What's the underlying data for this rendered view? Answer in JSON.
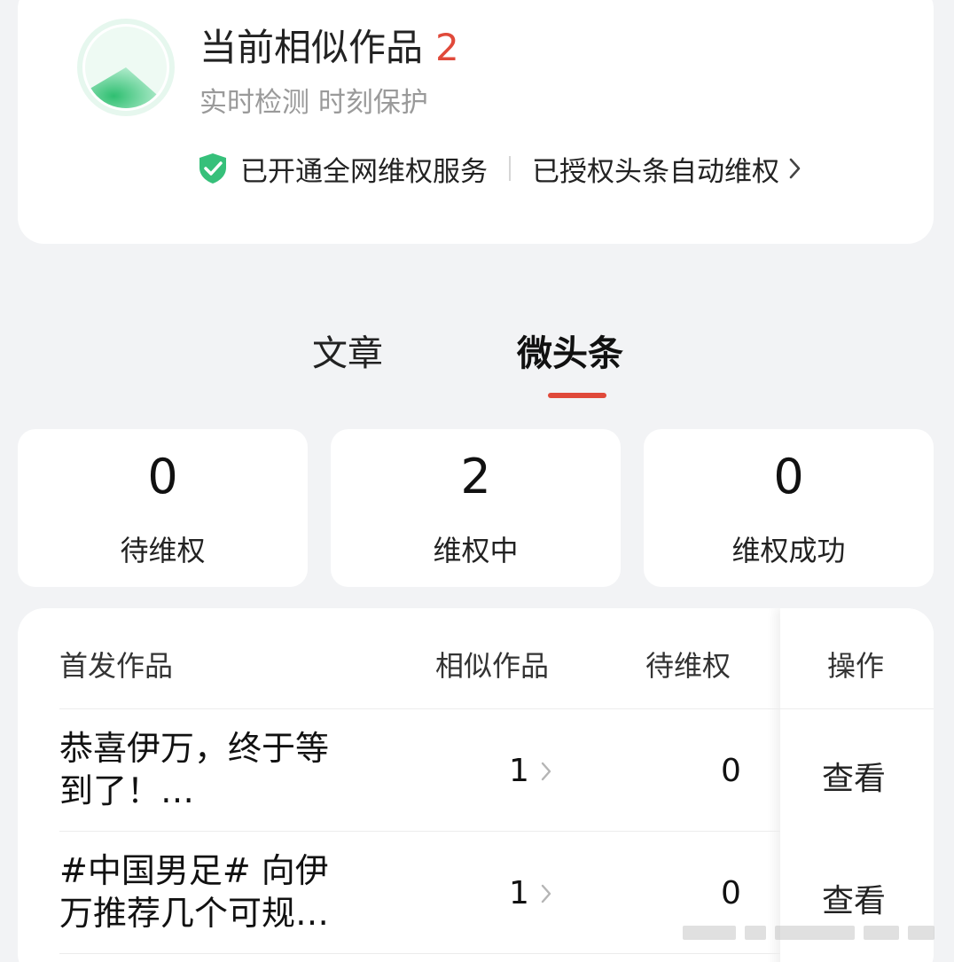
{
  "summary": {
    "title": "当前相似作品",
    "count": "2",
    "subtitle": "实时检测 时刻保护",
    "service_status": "已开通全网维权服务",
    "auth_link": "已授权头条自动维权",
    "gauge_fill_fraction": 0.3,
    "colors": {
      "accent_red": "#e0493a",
      "green": "#2fbf71"
    }
  },
  "tabs": [
    {
      "label": "文章",
      "active": false
    },
    {
      "label": "微头条",
      "active": true
    }
  ],
  "stats": [
    {
      "value": "0",
      "label": "待维权"
    },
    {
      "value": "2",
      "label": "维权中"
    },
    {
      "value": "0",
      "label": "维权成功"
    }
  ],
  "table": {
    "headers": {
      "work": "首发作品",
      "similar": "相似作品",
      "pending": "待维权",
      "action": "操作"
    },
    "rows": [
      {
        "title_line1": "恭喜伊万，终于等",
        "title_line2": "到了！…",
        "similar": "1",
        "pending": "0",
        "action": "查看"
      },
      {
        "title_line1": "#中国男足# 向伊",
        "title_line2": "万推荐几个可规…",
        "similar": "1",
        "pending": "0",
        "action": "查看"
      }
    ]
  }
}
